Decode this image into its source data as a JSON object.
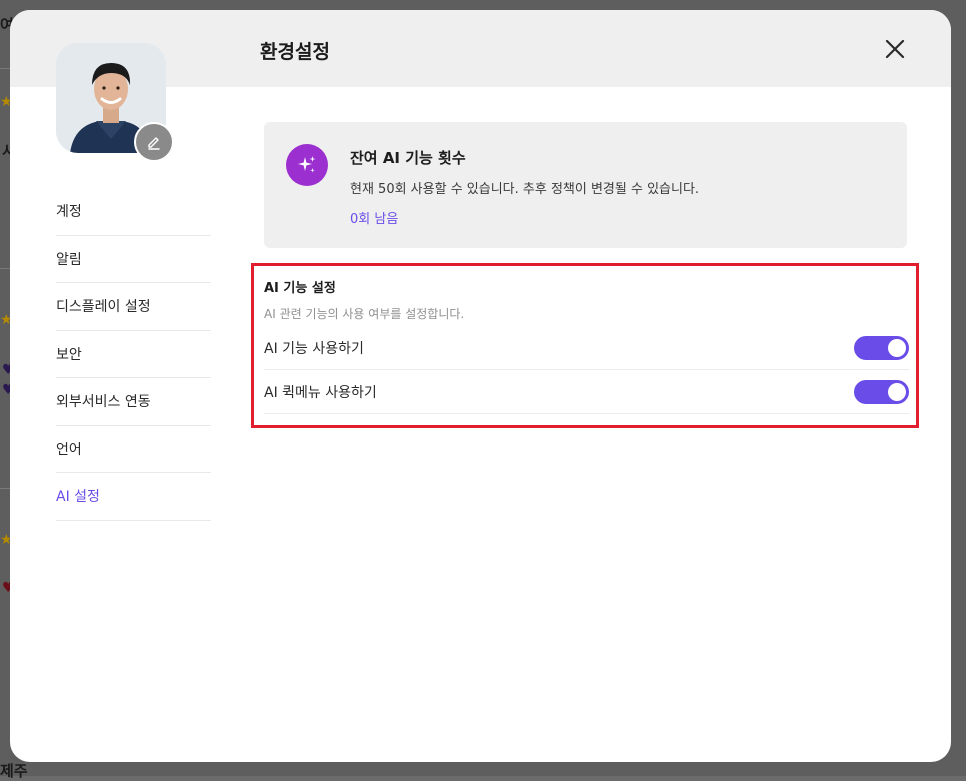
{
  "background": {
    "fragments": [
      "여",
      "시",
      "제주"
    ]
  },
  "modal": {
    "title": "환경설정"
  },
  "sidebar": {
    "items": [
      {
        "label": "계정"
      },
      {
        "label": "알림"
      },
      {
        "label": "디스플레이 설정"
      },
      {
        "label": "보안"
      },
      {
        "label": "외부서비스 연동"
      },
      {
        "label": "언어"
      },
      {
        "label": "AI 설정"
      }
    ],
    "active_index": 6
  },
  "ai_usage": {
    "title": "잔여 AI 기능 횟수",
    "description": "현재 50회 사용할 수 있습니다. 추후 정책이 변경될 수 있습니다.",
    "remaining": "0회 남음"
  },
  "ai_settings": {
    "title": "AI 기능 설정",
    "subtitle": "AI 관련 기능의 사용 여부를 설정합니다.",
    "options": [
      {
        "label": "AI 기능 사용하기",
        "enabled": true
      },
      {
        "label": "AI 퀵메뉴 사용하기",
        "enabled": true
      }
    ]
  },
  "colors": {
    "accent": "#6a4de8",
    "ai_icon": "#9b2fcf",
    "highlight_border": "#e01e2d"
  },
  "icons": {
    "close": "close-icon",
    "edit": "pencil-icon",
    "sparkle": "sparkle-icon"
  }
}
